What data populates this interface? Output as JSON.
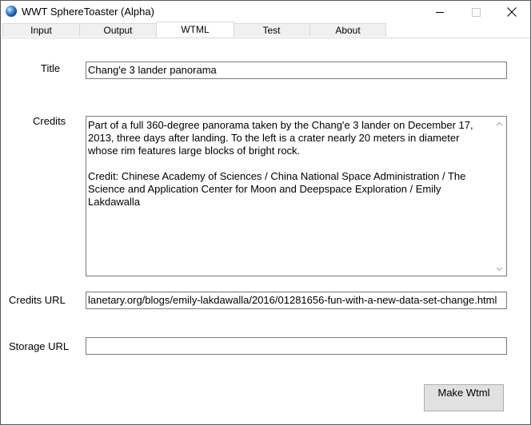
{
  "window": {
    "title": "WWT SphereToaster (Alpha)"
  },
  "tabs": [
    {
      "label": "Input"
    },
    {
      "label": "Output"
    },
    {
      "label": "WTML",
      "active": true
    },
    {
      "label": "Test"
    },
    {
      "label": "About"
    }
  ],
  "form": {
    "title_label": "Title",
    "title_value": "Chang'e 3 lander panorama",
    "credits_label": "Credits",
    "credits_value": "Part of a full 360-degree panorama taken by the Chang'e 3 lander on December 17, 2013, three days after landing. To the left is a crater nearly 20 meters in diameter whose rim features large blocks of bright rock.\n\nCredit: Chinese Academy of Sciences / China National Space Administration / The Science and Application Center for Moon and Deepspace Exploration / Emily Lakdawalla",
    "credits_url_label": "Credits URL",
    "credits_url_value": "lanetary.org/blogs/emily-lakdawalla/2016/01281656-fun-with-a-new-data-set-change.html",
    "storage_url_label": "Storage URL",
    "storage_url_value": ""
  },
  "actions": {
    "make_wtml_label": "Make Wtml"
  },
  "icons": {
    "app": "globe-icon",
    "minimize": "minimize-icon",
    "maximize": "maximize-icon",
    "close": "close-icon",
    "scroll_up": "chevron-up-icon",
    "scroll_down": "chevron-down-icon"
  }
}
